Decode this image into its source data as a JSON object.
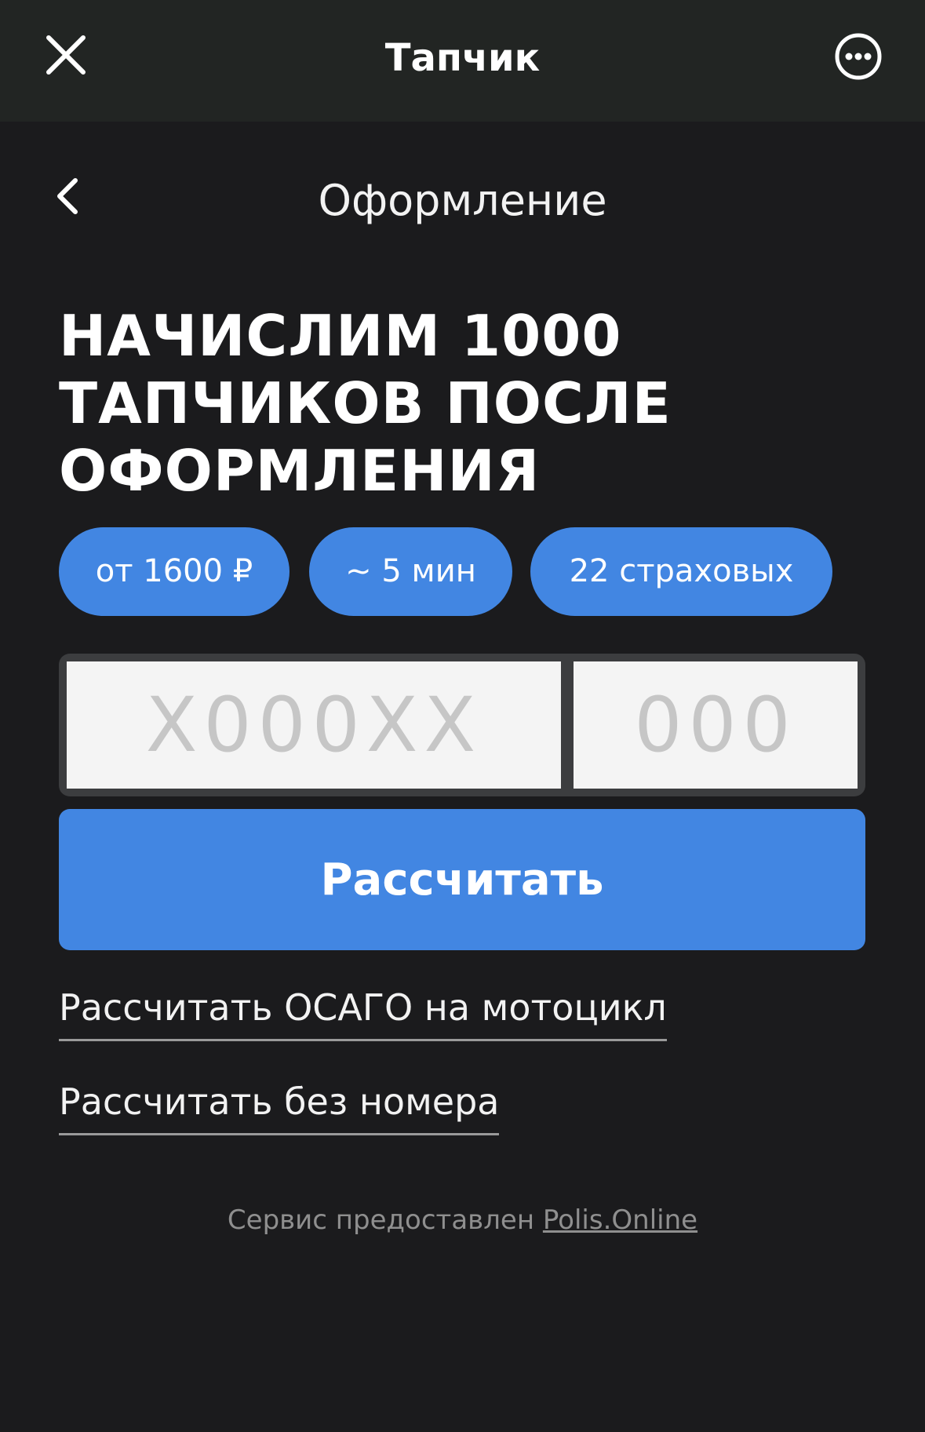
{
  "topbar": {
    "title": "Тапчик",
    "close_icon": "close-icon",
    "more_icon": "more-horizontal-circle-icon"
  },
  "subheader": {
    "title": "Оформление",
    "back_icon": "chevron-left-icon"
  },
  "headline": {
    "line1": "НАЧИСЛИМ 1000",
    "line2": "ТАПЧИКОВ ПОСЛЕ",
    "line3": "ОФОРМЛЕНИЯ"
  },
  "chips": [
    {
      "label": "от 1600 ₽"
    },
    {
      "label": "~ 5 мин"
    },
    {
      "label": "22 страховых"
    }
  ],
  "plate": {
    "number_placeholder": "X000XX",
    "number_value": "",
    "region_placeholder": "000",
    "region_value": ""
  },
  "calculate_button": {
    "label": "Рассчитать"
  },
  "links": {
    "moto": "Рассчитать ОСАГО на мотоцикл",
    "no_number": "Рассчитать без номера"
  },
  "footer": {
    "text": "Сервис предоставлен ",
    "brand": "Polis.Online"
  },
  "colors": {
    "background": "#1b1b1d",
    "topbar": "#222523",
    "accent": "#4286e2",
    "plate_field": "#f4f4f4"
  }
}
